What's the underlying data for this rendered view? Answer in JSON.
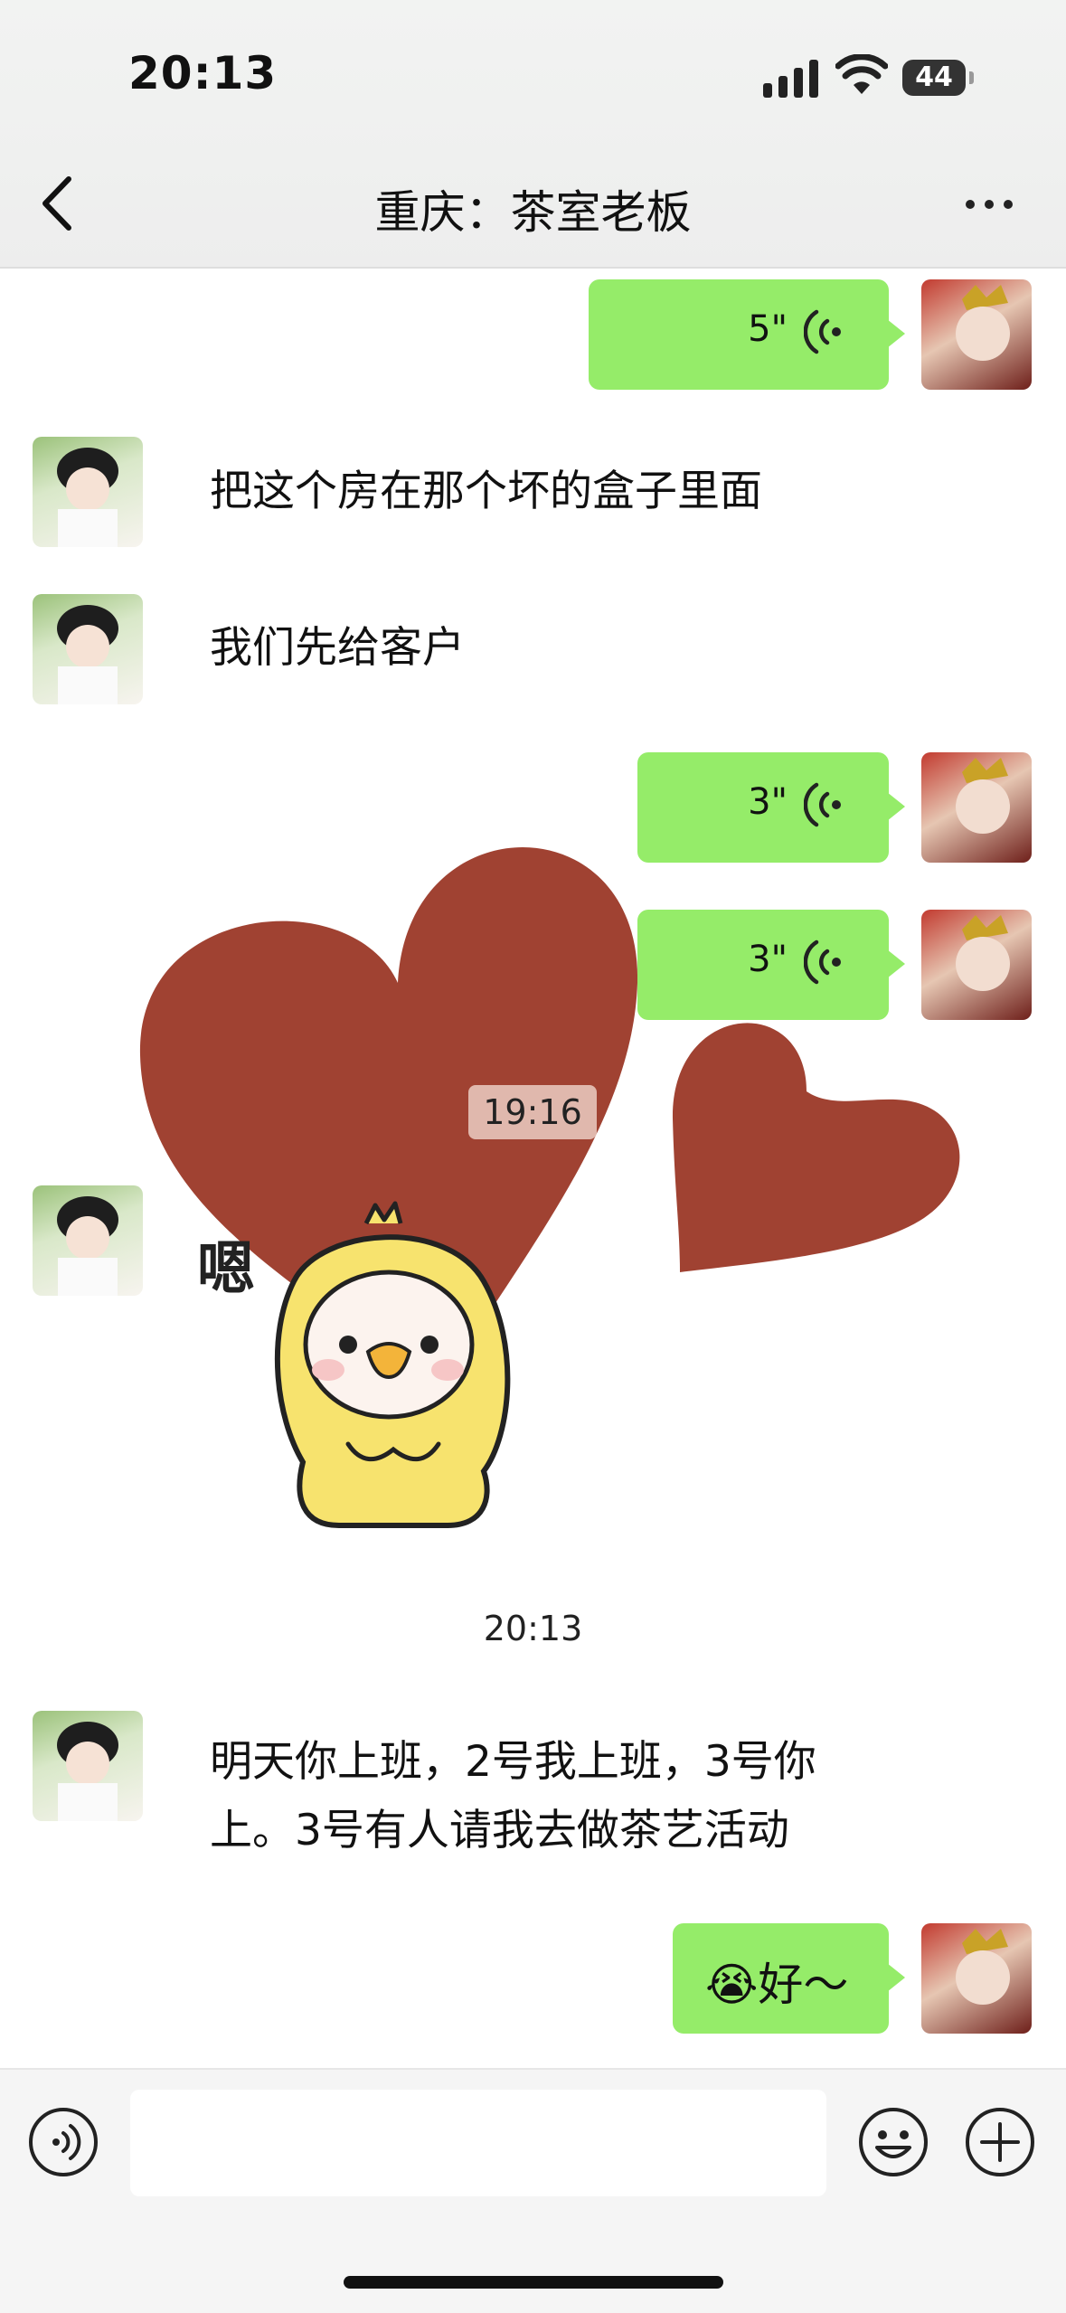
{
  "status_bar": {
    "time": "20:13",
    "battery": "44"
  },
  "nav": {
    "title": "重庆：茶室老板"
  },
  "chat": {
    "messages": [
      {
        "from": "self",
        "type": "voice",
        "duration": "5\""
      },
      {
        "from": "friend",
        "type": "text",
        "text": "把这个房在那个坏的盒子里面"
      },
      {
        "from": "friend",
        "type": "text",
        "text": "我们先给客户"
      },
      {
        "from": "self",
        "type": "voice",
        "duration": "3\""
      },
      {
        "from": "self",
        "type": "voice",
        "duration": "3\""
      },
      {
        "type": "time",
        "text": "19:16"
      },
      {
        "from": "friend",
        "type": "sticker",
        "caption": "嗯"
      },
      {
        "type": "time",
        "text": "20:13"
      },
      {
        "from": "friend",
        "type": "text",
        "lines": [
          "明天你上班，2号我上班，3号你",
          "上。3号有人请我去做茶艺活动"
        ]
      },
      {
        "from": "self",
        "type": "text",
        "text": "😭好～"
      }
    ]
  },
  "colors": {
    "bubble_self": "#95ec69",
    "heart": "#a04232",
    "chick": "#f7e36e"
  },
  "icons": [
    "back-icon",
    "more-icon",
    "voice-wave-icon",
    "voice-mode-icon",
    "emoji-icon",
    "plus-icon",
    "signal-icon",
    "wifi-icon",
    "battery-icon"
  ]
}
